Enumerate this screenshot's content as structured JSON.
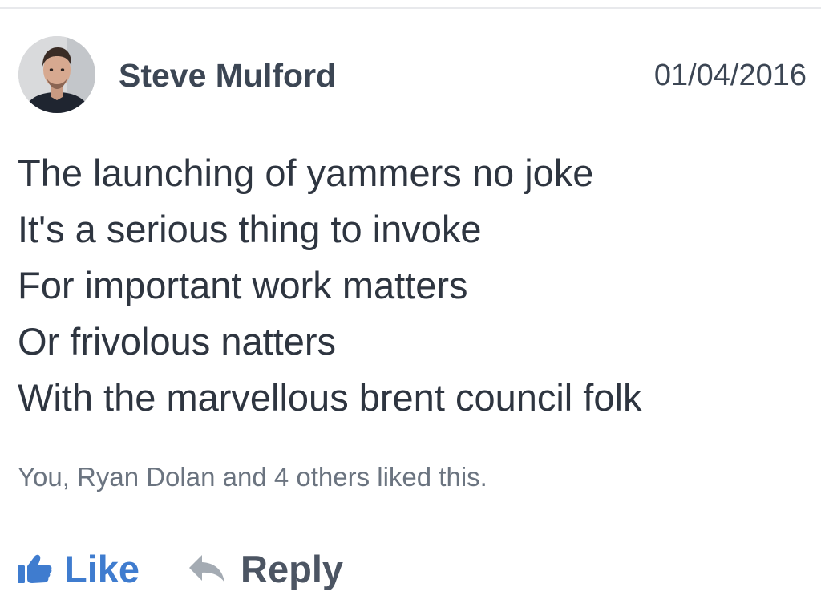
{
  "post": {
    "author": {
      "name": "Steve Mulford",
      "avatar_icon": "person-photo"
    },
    "date": "01/04/2016",
    "body_lines": [
      "The launching of yammers no joke",
      "It's a serious thing to invoke",
      "For important work matters",
      "Or frivolous natters",
      "With the marvellous brent council folk"
    ],
    "likes_summary": "You, Ryan Dolan and 4 others liked this.",
    "actions": {
      "like": {
        "label": "Like",
        "icon": "thumbs-up-icon",
        "color": "#3f7ccf"
      },
      "reply": {
        "label": "Reply",
        "icon": "reply-arrow-icon",
        "color": "#4c5563"
      }
    }
  }
}
